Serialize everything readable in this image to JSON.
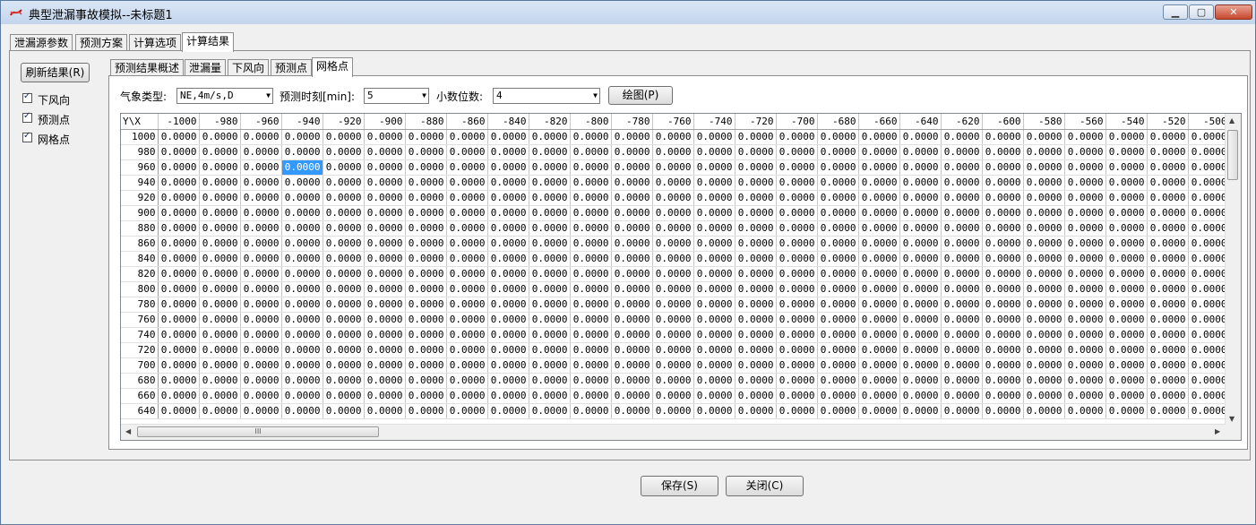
{
  "window": {
    "title": "典型泄漏事故模拟--未标题1",
    "minimize_label": "▁",
    "maximize_label": "▢",
    "close_label": "✕"
  },
  "main_tabs": [
    "泄漏源参数",
    "预测方案",
    "计算选项",
    "计算结果"
  ],
  "active_main_tab": 3,
  "sidebar": {
    "refresh_label": "刷新结果(R)",
    "checkboxes": [
      {
        "label": "下风向",
        "checked": true
      },
      {
        "label": "预测点",
        "checked": true
      },
      {
        "label": "网格点",
        "checked": true
      }
    ]
  },
  "sub_tabs": [
    "预测结果概述",
    "泄漏量",
    "下风向",
    "预测点",
    "网格点"
  ],
  "active_sub_tab": 4,
  "controls": {
    "weather_label": "气象类型:",
    "weather_value": "NE,4m/s,D",
    "time_label": "预测时刻[min]:",
    "time_value": "5",
    "decimals_label": "小数位数:",
    "decimals_value": "4",
    "plot_label": "绘图(P)"
  },
  "grid": {
    "corner": "Y\\X",
    "columns": [
      "-1000",
      "-980",
      "-960",
      "-940",
      "-920",
      "-900",
      "-880",
      "-860",
      "-840",
      "-820",
      "-800",
      "-780",
      "-760",
      "-740",
      "-720",
      "-700",
      "-680",
      "-660",
      "-640",
      "-620",
      "-600",
      "-580",
      "-560",
      "-540",
      "-520",
      "-500"
    ],
    "rows": [
      "1000",
      "980",
      "960",
      "940",
      "920",
      "900",
      "880",
      "860",
      "840",
      "820",
      "800",
      "780",
      "760",
      "740",
      "720",
      "700",
      "680",
      "660",
      "640"
    ],
    "cell_value": "0.0000",
    "selected_cell": {
      "row": 2,
      "col": 3
    },
    "hscroll_grip": "III"
  },
  "footer": {
    "save_label": "保存(S)",
    "close_label": "关闭(C)"
  },
  "colors": {
    "selection": "#3399ff",
    "titlebar": "#c3d5ec",
    "close_button": "#c7462c"
  }
}
